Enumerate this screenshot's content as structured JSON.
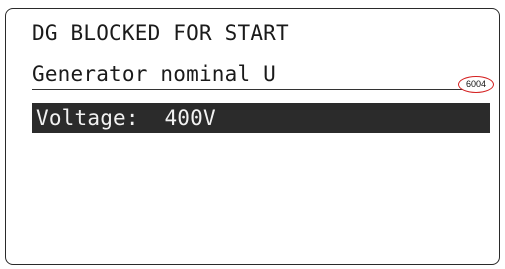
{
  "display": {
    "status_text": "DG BLOCKED FOR START",
    "parameter_name": "Generator nominal U",
    "parameter_code": "6004",
    "value_label": "Voltage:",
    "value": "400V"
  }
}
